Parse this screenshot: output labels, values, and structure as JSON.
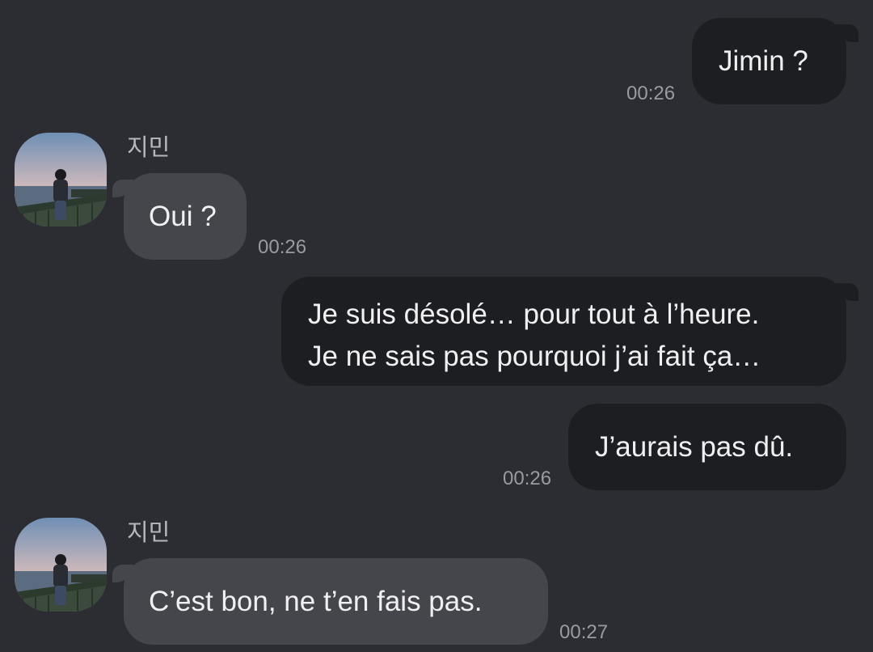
{
  "messages": [
    {
      "direction": "out",
      "text": "Jimin ?",
      "time": "00:26"
    },
    {
      "direction": "in",
      "sender": "지민",
      "text": "Oui ?",
      "time": "00:26"
    },
    {
      "direction": "out",
      "lines": [
        "Je suis désolé… pour tout à l’heure.",
        "Je ne sais pas pourquoi j’ai fait ça…"
      ]
    },
    {
      "direction": "out",
      "text": "J’aurais pas dû.",
      "time": "00:26"
    },
    {
      "direction": "in",
      "sender": "지민",
      "text": "C’est bon, ne t’en fais pas.",
      "time": "00:27"
    }
  ],
  "colors": {
    "background": "#2c2d32",
    "outgoing_bubble": "#1d1e22",
    "incoming_bubble": "#45464c",
    "text": "#f0f0f2",
    "timestamp": "#9a9ba1"
  },
  "avatar_icon": "profile-photo-person-on-railing-by-sea"
}
